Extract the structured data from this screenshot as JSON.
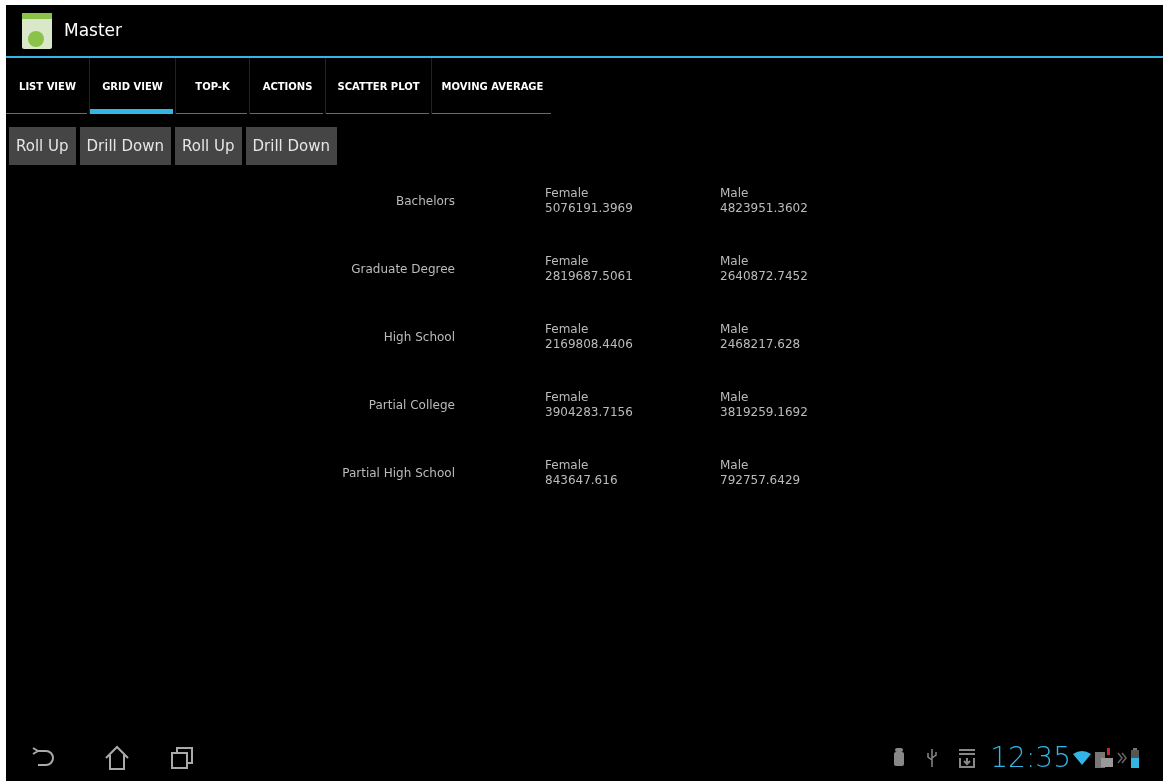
{
  "title": "Master",
  "tabs": [
    {
      "label": "LIST VIEW",
      "selected": false
    },
    {
      "label": "GRID VIEW",
      "selected": true
    },
    {
      "label": "TOP-K",
      "selected": false
    },
    {
      "label": "ACTIONS",
      "selected": false
    },
    {
      "label": "SCATTER PLOT",
      "selected": false
    },
    {
      "label": "MOVING AVERAGE",
      "selected": false
    }
  ],
  "buttons": [
    "Roll Up",
    "Drill Down",
    "Roll Up",
    "Drill Down"
  ],
  "rows": [
    {
      "label": "Bachelors",
      "female_label": "Female",
      "female_value": "5076191.3969",
      "male_label": "Male",
      "male_value": "4823951.3602"
    },
    {
      "label": "Graduate Degree",
      "female_label": "Female",
      "female_value": "2819687.5061",
      "male_label": "Male",
      "male_value": "2640872.7452"
    },
    {
      "label": "High School",
      "female_label": "Female",
      "female_value": "2169808.4406",
      "male_label": "Male",
      "male_value": "2468217.628"
    },
    {
      "label": "Partial College",
      "female_label": "Female",
      "female_value": "3904283.7156",
      "male_label": "Male",
      "male_value": "3819259.1692"
    },
    {
      "label": "Partial High School",
      "female_label": "Female",
      "female_value": "843647.616",
      "male_label": "Male",
      "male_value": "792757.6429"
    }
  ],
  "status_bar": {
    "time": "12:35"
  }
}
